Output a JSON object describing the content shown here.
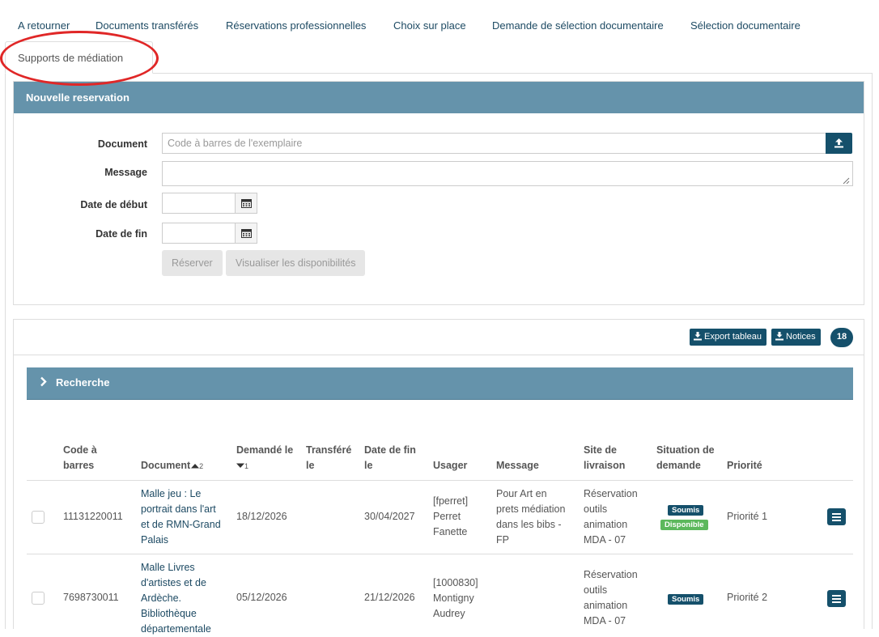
{
  "tabs": [
    {
      "label": "A retourner"
    },
    {
      "label": "Documents transférés"
    },
    {
      "label": "Réservations professionnelles"
    },
    {
      "label": "Choix sur place"
    },
    {
      "label": "Demande de sélection documentaire"
    },
    {
      "label": "Sélection documentaire"
    },
    {
      "label": "Supports de médiation"
    }
  ],
  "new_reservation": {
    "title": "Nouvelle reservation",
    "document_label": "Document",
    "document_placeholder": "Code à barres de l'exemplaire",
    "message_label": "Message",
    "start_label": "Date de début",
    "end_label": "Date de fin",
    "reserve_button": "Réserver",
    "availability_button": "Visualiser les disponibilités"
  },
  "list": {
    "export_button": "Export tableau",
    "notices_button": "Notices",
    "count": "18",
    "search_label": "Recherche",
    "headers": {
      "barcode_1": "Code à",
      "barcode_2": "barres",
      "document": "Document",
      "document_sort": "2",
      "requested_1": "Demandé le",
      "requested_sort": "1",
      "transferred_1": "Transféré",
      "transferred_2": "le",
      "end_1": "Date de fin",
      "end_2": "le",
      "user": "Usager",
      "message": "Message",
      "site_1": "Site de",
      "site_2": "livraison",
      "status_1": "Situation de",
      "status_2": "demande",
      "priority": "Priorité"
    },
    "rows": [
      {
        "barcode": "11131220011",
        "document_lines": [
          "Malle jeu : Le",
          "portrait dans l'art",
          "et de RMN-Grand",
          "Palais"
        ],
        "requested": "18/12/2026",
        "transferred": "",
        "end": "30/04/2027",
        "user_lines": [
          "[fperret]",
          "Perret",
          "Fanette"
        ],
        "message_lines": [
          "Pour Art en",
          "prets médiation",
          "dans les bibs -",
          "FP"
        ],
        "site_lines": [
          "Réservation",
          "outils",
          "animation",
          "MDA - 07"
        ],
        "status_badges": [
          "Soumis",
          "Disponible"
        ],
        "priority": "Priorité 1"
      },
      {
        "barcode": "7698730011",
        "document_lines": [
          "Malle Livres",
          "d'artistes et de",
          "Ardèche.",
          "Bibliothèque",
          "départementale"
        ],
        "requested": "05/12/2026",
        "transferred": "",
        "end": "21/12/2026",
        "user_lines": [
          "[1000830]",
          "Montigny",
          "Audrey"
        ],
        "message_lines": [],
        "site_lines": [
          "Réservation",
          "outils",
          "animation",
          "MDA - 07"
        ],
        "status_badges": [
          "Soumis"
        ],
        "priority": "Priorité 2"
      }
    ]
  }
}
